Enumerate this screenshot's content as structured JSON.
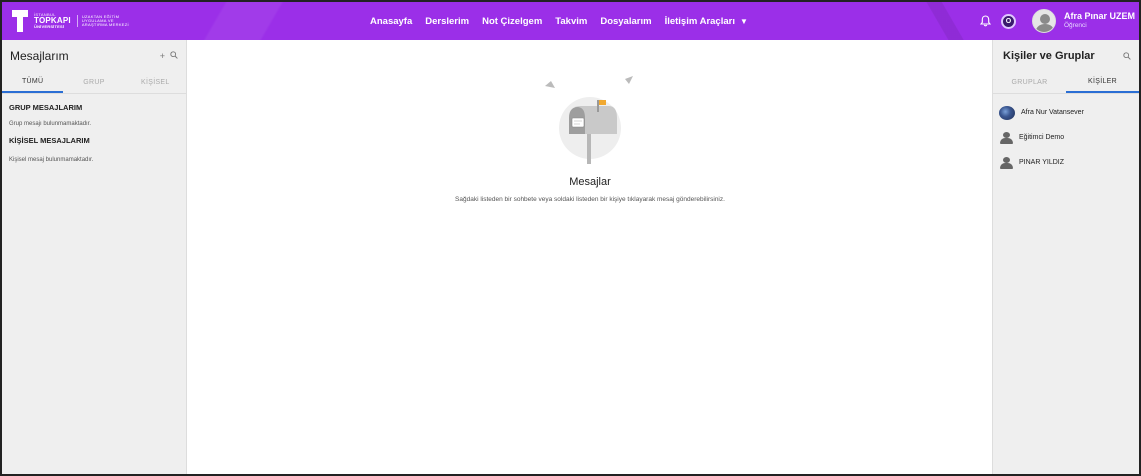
{
  "header": {
    "logo": {
      "line_small": "İSTANBUL",
      "line_big": "TOPKAPI",
      "line_sub": "ÜNİVERSİTESİ",
      "right_lines": [
        "UZAKTAN EĞİTİM",
        "UYGULAMA VE",
        "ARAŞTIRMA MERKEZİ"
      ]
    },
    "nav": [
      "Anasayfa",
      "Derslerim",
      "Not Çizelgem",
      "Takvim",
      "Dosyalarım",
      "İletişim Araçları"
    ],
    "nav_dropdown_glyph": "▼",
    "notification_icon": "bell-icon",
    "status_badge": "O",
    "user": {
      "name": "Afra Pınar UZEM",
      "role": "Öğrenci"
    },
    "brand_color": "#9b2fe8"
  },
  "left_panel": {
    "title": "Mesajlarım",
    "tools": [
      "+",
      "🔍"
    ],
    "tabs": [
      "TÜMÜ",
      "GRUP",
      "KİŞİSEL"
    ],
    "active_tab": "TÜMÜ",
    "sections": [
      {
        "heading": "GRUP MESAJLARIM",
        "empty_text": "Grup mesajı bulunmamaktadır."
      },
      {
        "heading": "KİŞİSEL MESAJLARIM",
        "empty_text": "Kişisel mesaj bulunmamaktadır."
      }
    ]
  },
  "center": {
    "title": "Mesajlar",
    "text": "Sağdaki listeden bir sohbete veya soldaki listeden bir kişiye tıklayarak mesaj gönderebilirsiniz."
  },
  "right_panel": {
    "title": "Kişiler ve Gruplar",
    "search_icon": "🔍",
    "tabs": [
      "GRUPLAR",
      "KİŞİLER"
    ],
    "active_tab": "KİŞİLER",
    "contacts": [
      {
        "name": "Afra Nur Vatansever",
        "avatar": "photo"
      },
      {
        "name": "Eğitimci Demo",
        "avatar": "user-icon"
      },
      {
        "name": "PINAR YILDIZ",
        "avatar": "user-icon"
      }
    ],
    "tab_accent": "#2a6ed4"
  }
}
